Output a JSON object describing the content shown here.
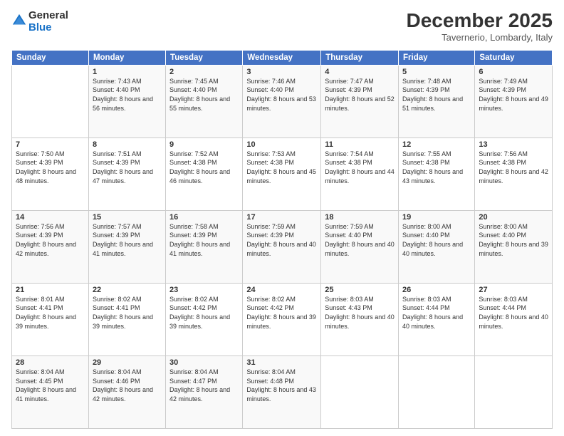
{
  "logo": {
    "general": "General",
    "blue": "Blue"
  },
  "header": {
    "month": "December 2025",
    "location": "Tavernerio, Lombardy, Italy"
  },
  "days_header": [
    "Sunday",
    "Monday",
    "Tuesday",
    "Wednesday",
    "Thursday",
    "Friday",
    "Saturday"
  ],
  "weeks": [
    [
      {
        "day": "",
        "sunrise": "",
        "sunset": "",
        "daylight": ""
      },
      {
        "day": "1",
        "sunrise": "Sunrise: 7:43 AM",
        "sunset": "Sunset: 4:40 PM",
        "daylight": "Daylight: 8 hours and 56 minutes."
      },
      {
        "day": "2",
        "sunrise": "Sunrise: 7:45 AM",
        "sunset": "Sunset: 4:40 PM",
        "daylight": "Daylight: 8 hours and 55 minutes."
      },
      {
        "day": "3",
        "sunrise": "Sunrise: 7:46 AM",
        "sunset": "Sunset: 4:40 PM",
        "daylight": "Daylight: 8 hours and 53 minutes."
      },
      {
        "day": "4",
        "sunrise": "Sunrise: 7:47 AM",
        "sunset": "Sunset: 4:39 PM",
        "daylight": "Daylight: 8 hours and 52 minutes."
      },
      {
        "day": "5",
        "sunrise": "Sunrise: 7:48 AM",
        "sunset": "Sunset: 4:39 PM",
        "daylight": "Daylight: 8 hours and 51 minutes."
      },
      {
        "day": "6",
        "sunrise": "Sunrise: 7:49 AM",
        "sunset": "Sunset: 4:39 PM",
        "daylight": "Daylight: 8 hours and 49 minutes."
      }
    ],
    [
      {
        "day": "7",
        "sunrise": "Sunrise: 7:50 AM",
        "sunset": "Sunset: 4:39 PM",
        "daylight": "Daylight: 8 hours and 48 minutes."
      },
      {
        "day": "8",
        "sunrise": "Sunrise: 7:51 AM",
        "sunset": "Sunset: 4:39 PM",
        "daylight": "Daylight: 8 hours and 47 minutes."
      },
      {
        "day": "9",
        "sunrise": "Sunrise: 7:52 AM",
        "sunset": "Sunset: 4:38 PM",
        "daylight": "Daylight: 8 hours and 46 minutes."
      },
      {
        "day": "10",
        "sunrise": "Sunrise: 7:53 AM",
        "sunset": "Sunset: 4:38 PM",
        "daylight": "Daylight: 8 hours and 45 minutes."
      },
      {
        "day": "11",
        "sunrise": "Sunrise: 7:54 AM",
        "sunset": "Sunset: 4:38 PM",
        "daylight": "Daylight: 8 hours and 44 minutes."
      },
      {
        "day": "12",
        "sunrise": "Sunrise: 7:55 AM",
        "sunset": "Sunset: 4:38 PM",
        "daylight": "Daylight: 8 hours and 43 minutes."
      },
      {
        "day": "13",
        "sunrise": "Sunrise: 7:56 AM",
        "sunset": "Sunset: 4:38 PM",
        "daylight": "Daylight: 8 hours and 42 minutes."
      }
    ],
    [
      {
        "day": "14",
        "sunrise": "Sunrise: 7:56 AM",
        "sunset": "Sunset: 4:39 PM",
        "daylight": "Daylight: 8 hours and 42 minutes."
      },
      {
        "day": "15",
        "sunrise": "Sunrise: 7:57 AM",
        "sunset": "Sunset: 4:39 PM",
        "daylight": "Daylight: 8 hours and 41 minutes."
      },
      {
        "day": "16",
        "sunrise": "Sunrise: 7:58 AM",
        "sunset": "Sunset: 4:39 PM",
        "daylight": "Daylight: 8 hours and 41 minutes."
      },
      {
        "day": "17",
        "sunrise": "Sunrise: 7:59 AM",
        "sunset": "Sunset: 4:39 PM",
        "daylight": "Daylight: 8 hours and 40 minutes."
      },
      {
        "day": "18",
        "sunrise": "Sunrise: 7:59 AM",
        "sunset": "Sunset: 4:40 PM",
        "daylight": "Daylight: 8 hours and 40 minutes."
      },
      {
        "day": "19",
        "sunrise": "Sunrise: 8:00 AM",
        "sunset": "Sunset: 4:40 PM",
        "daylight": "Daylight: 8 hours and 40 minutes."
      },
      {
        "day": "20",
        "sunrise": "Sunrise: 8:00 AM",
        "sunset": "Sunset: 4:40 PM",
        "daylight": "Daylight: 8 hours and 39 minutes."
      }
    ],
    [
      {
        "day": "21",
        "sunrise": "Sunrise: 8:01 AM",
        "sunset": "Sunset: 4:41 PM",
        "daylight": "Daylight: 8 hours and 39 minutes."
      },
      {
        "day": "22",
        "sunrise": "Sunrise: 8:02 AM",
        "sunset": "Sunset: 4:41 PM",
        "daylight": "Daylight: 8 hours and 39 minutes."
      },
      {
        "day": "23",
        "sunrise": "Sunrise: 8:02 AM",
        "sunset": "Sunset: 4:42 PM",
        "daylight": "Daylight: 8 hours and 39 minutes."
      },
      {
        "day": "24",
        "sunrise": "Sunrise: 8:02 AM",
        "sunset": "Sunset: 4:42 PM",
        "daylight": "Daylight: 8 hours and 39 minutes."
      },
      {
        "day": "25",
        "sunrise": "Sunrise: 8:03 AM",
        "sunset": "Sunset: 4:43 PM",
        "daylight": "Daylight: 8 hours and 40 minutes."
      },
      {
        "day": "26",
        "sunrise": "Sunrise: 8:03 AM",
        "sunset": "Sunset: 4:44 PM",
        "daylight": "Daylight: 8 hours and 40 minutes."
      },
      {
        "day": "27",
        "sunrise": "Sunrise: 8:03 AM",
        "sunset": "Sunset: 4:44 PM",
        "daylight": "Daylight: 8 hours and 40 minutes."
      }
    ],
    [
      {
        "day": "28",
        "sunrise": "Sunrise: 8:04 AM",
        "sunset": "Sunset: 4:45 PM",
        "daylight": "Daylight: 8 hours and 41 minutes."
      },
      {
        "day": "29",
        "sunrise": "Sunrise: 8:04 AM",
        "sunset": "Sunset: 4:46 PM",
        "daylight": "Daylight: 8 hours and 42 minutes."
      },
      {
        "day": "30",
        "sunrise": "Sunrise: 8:04 AM",
        "sunset": "Sunset: 4:47 PM",
        "daylight": "Daylight: 8 hours and 42 minutes."
      },
      {
        "day": "31",
        "sunrise": "Sunrise: 8:04 AM",
        "sunset": "Sunset: 4:48 PM",
        "daylight": "Daylight: 8 hours and 43 minutes."
      },
      {
        "day": "",
        "sunrise": "",
        "sunset": "",
        "daylight": ""
      },
      {
        "day": "",
        "sunrise": "",
        "sunset": "",
        "daylight": ""
      },
      {
        "day": "",
        "sunrise": "",
        "sunset": "",
        "daylight": ""
      }
    ]
  ]
}
